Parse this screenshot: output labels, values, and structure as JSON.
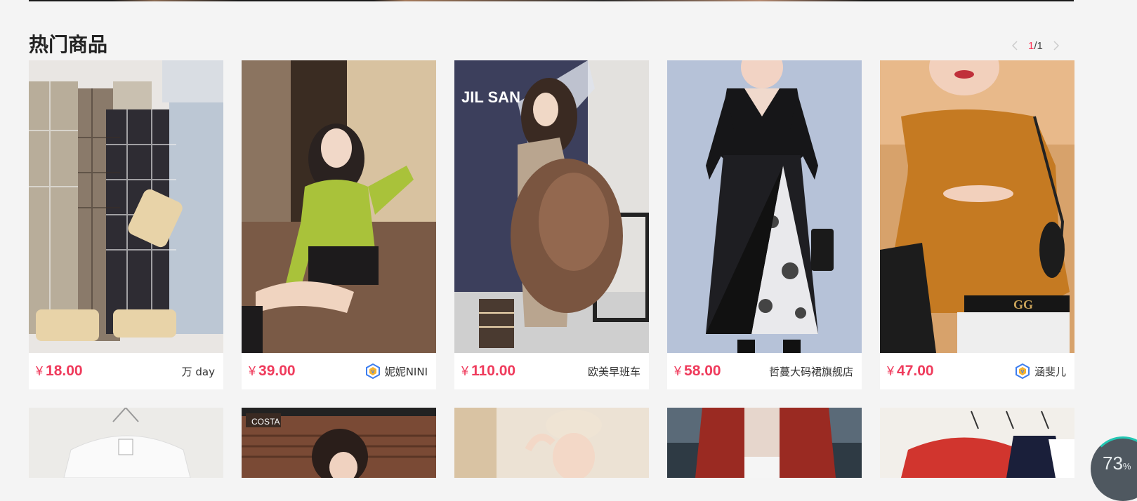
{
  "section": {
    "title": "热门商品"
  },
  "pager": {
    "current": "1",
    "separator": "/",
    "total": "1"
  },
  "products": [
    {
      "price": "18.00",
      "currency": "¥",
      "shop": "万 day",
      "verified": false
    },
    {
      "price": "39.00",
      "currency": "¥",
      "shop": "妮妮NINI",
      "verified": true
    },
    {
      "price": "110.00",
      "currency": "¥",
      "shop": "欧美早班车",
      "verified": false
    },
    {
      "price": "58.00",
      "currency": "¥",
      "shop": "哲蔓大码裙旗舰店",
      "verified": false
    },
    {
      "price": "47.00",
      "currency": "¥",
      "shop": "涵斐儿",
      "verified": true
    }
  ],
  "loader": {
    "value": "73",
    "unit": "%"
  },
  "colors": {
    "price": "#ef3b5c",
    "background": "#f4f4f4",
    "pager_active": "#ff3355"
  }
}
